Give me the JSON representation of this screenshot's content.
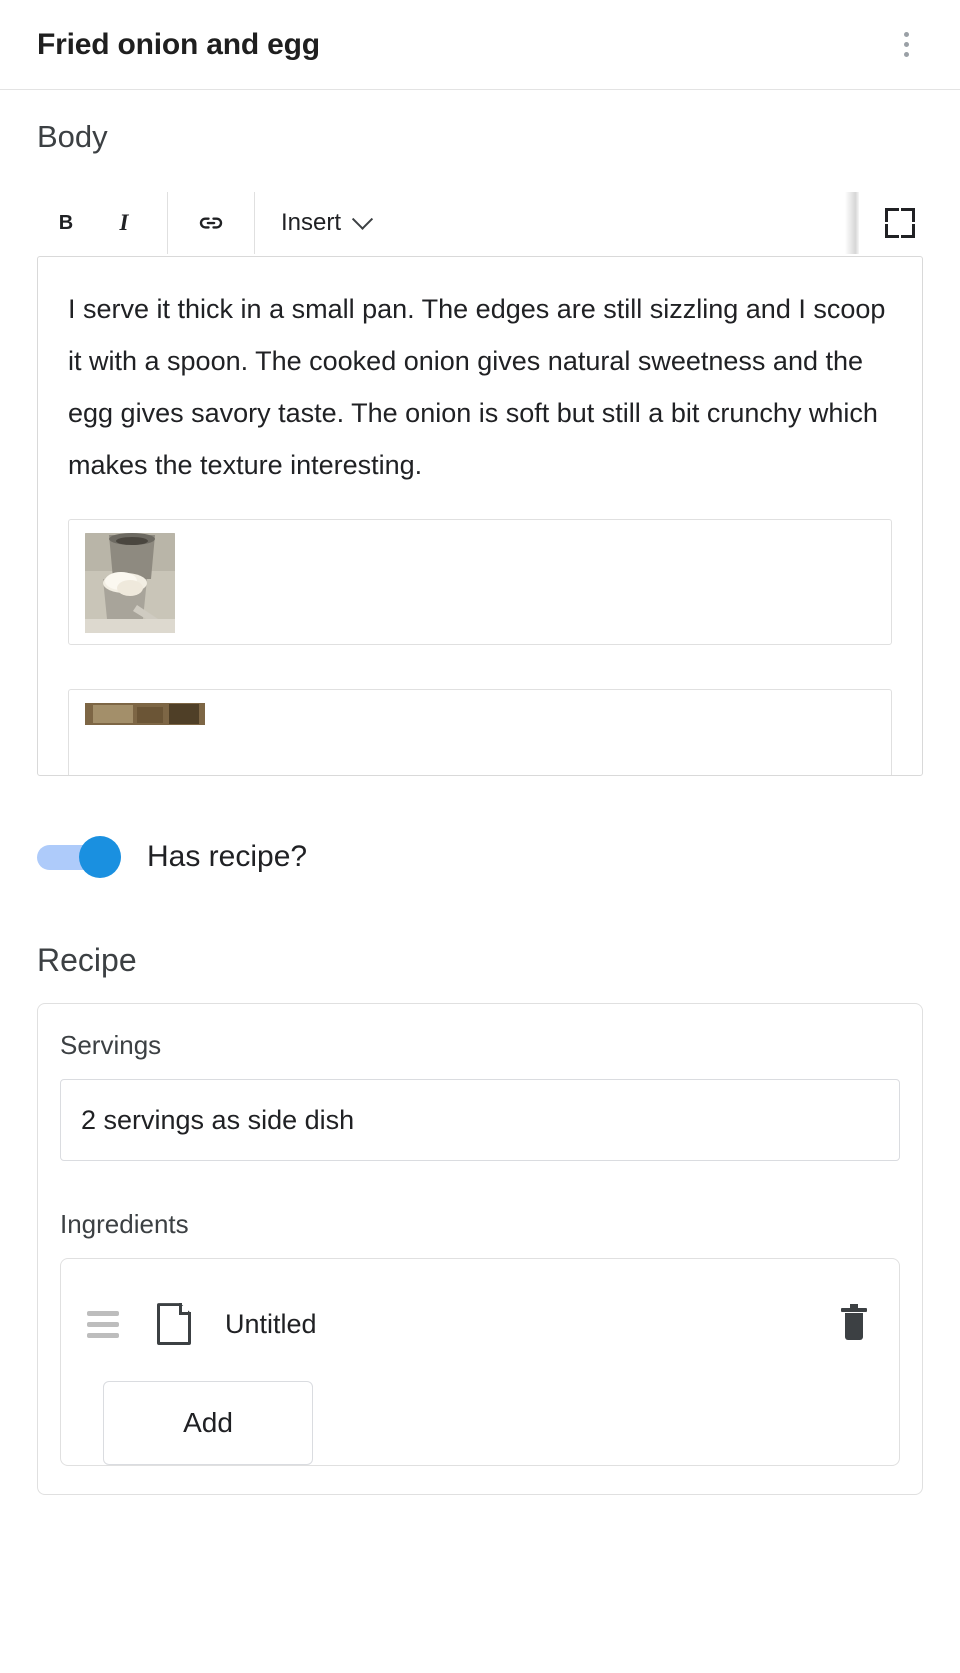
{
  "header": {
    "title": "Fried onion and egg",
    "menu_icon": "kebab-menu-icon"
  },
  "body_section": {
    "label": "Body",
    "toolbar": {
      "bold_label": "B",
      "italic_label": "I",
      "link_icon": "link-icon",
      "insert_label": "Insert",
      "chevron_icon": "chevron-down-icon",
      "expand_icon": "fullscreen-expand-icon"
    },
    "content": "I serve it thick in a small pan. The edges are still sizzling and I scoop it with a spoon. The cooked onion gives natural sweetness and the egg gives savory taste. The onion is soft but still a bit crunchy which makes the texture interesting.",
    "embeds": [
      {
        "name": "image-embed-1",
        "icon": "image-thumbnail"
      },
      {
        "name": "image-embed-2",
        "icon": "image-thumbnail"
      }
    ]
  },
  "has_recipe_toggle": {
    "label": "Has recipe?",
    "state": "on",
    "track_color": "#aecbfa",
    "knob_color": "#1a90e0"
  },
  "recipe": {
    "heading": "Recipe",
    "servings": {
      "label": "Servings",
      "value": "2 servings as side dish",
      "placeholder": "Servings"
    },
    "ingredients": {
      "label": "Ingredients",
      "rows": [
        {
          "drag_icon": "drag-handle-icon",
          "file_icon": "document-icon",
          "title": "Untitled",
          "delete_icon": "trash-icon"
        }
      ],
      "add_label": "Add"
    }
  }
}
